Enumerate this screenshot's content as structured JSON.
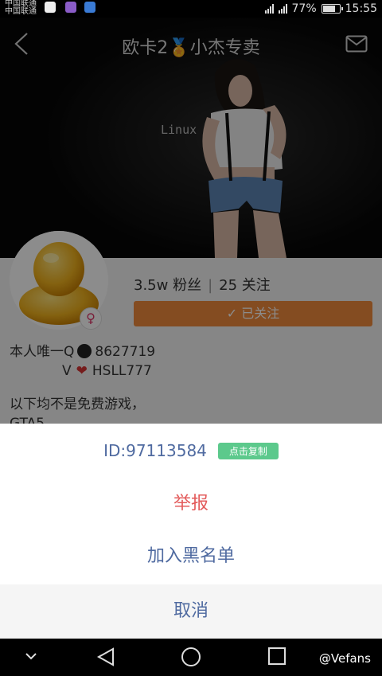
{
  "status_bar": {
    "carrier_line1": "中国联通",
    "carrier_line2": "中国联通",
    "battery_percent": "77%",
    "battery_level": 0.77,
    "time": "15:55"
  },
  "header": {
    "title_part1": "欧卡2",
    "title_medal": "🏅",
    "title_part2": "小杰专卖",
    "hero_image_text": "Linux"
  },
  "profile": {
    "fans": "3.5w 粉丝",
    "following": "25 关注",
    "follow_button": "✓ 已关注",
    "gender_symbol": "♀",
    "bio_line1_prefix": "本人唯一Q",
    "bio_line1_number": "8627719",
    "bio_line2_prefix": "V",
    "bio_line2_heart": "❤",
    "bio_line2_value": "HSLL777",
    "desc_line1": "以下均不是免费游戏，",
    "desc_line2": "GTA5"
  },
  "action_sheet": {
    "id_text": "ID:97113584",
    "copy_label": "点击复制",
    "report_label": "举报",
    "blacklist_label": "加入黑名单",
    "cancel_label": "取消"
  },
  "nav_bar": {
    "watermark": "@Vefans"
  },
  "colors": {
    "accent_blue": "#4f6aa0",
    "report_red": "#e35b5b",
    "copy_green": "#5cc98c",
    "follow_orange": "#f08a3c"
  }
}
